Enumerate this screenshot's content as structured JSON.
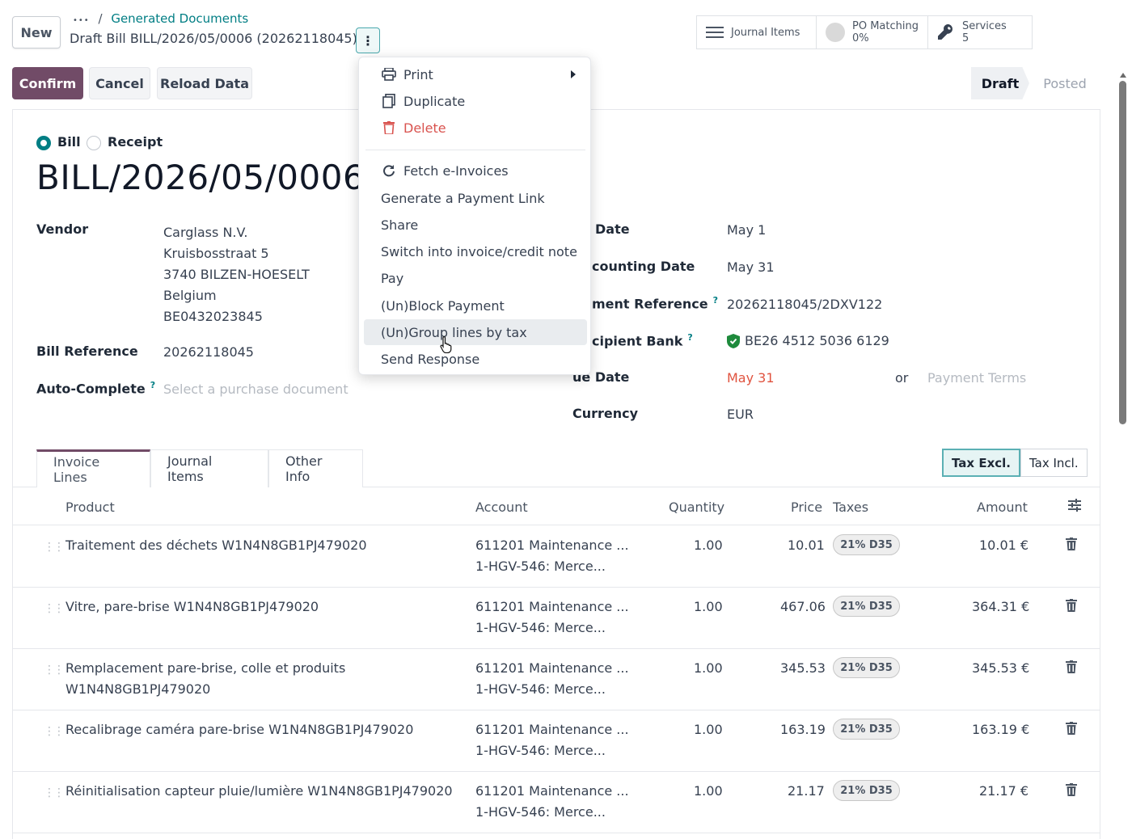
{
  "header": {
    "new_label": "New",
    "breadcrumb_ellipsis": "•••",
    "breadcrumb_sep": "/",
    "breadcrumb_link": "Generated Documents",
    "record_title": "Draft Bill BILL/2026/05/0006 (20262118045)",
    "gear_glyph": "⋮"
  },
  "smart_buttons": [
    {
      "label": "Journal Items",
      "value": "",
      "icon": "list-icon"
    },
    {
      "label": "PO Matching",
      "value": "0%",
      "icon": "progress-circle-icon"
    },
    {
      "label": "Services",
      "value": "5",
      "icon": "wrench-icon"
    }
  ],
  "actions": {
    "confirm": "Confirm",
    "cancel": "Cancel",
    "reload": "Reload Data"
  },
  "statusbar": {
    "draft": "Draft",
    "posted": "Posted"
  },
  "form": {
    "type_options": {
      "bill": "Bill",
      "receipt": "Receipt",
      "selected": "Bill"
    },
    "bill_number": "BILL/2026/05/0006",
    "vendor_label": "Vendor",
    "vendor_lines": [
      "Carglass N.V.",
      "Kruisbosstraat 5",
      "3740 BILZEN-HOESELT",
      "Belgium",
      "BE0432023845"
    ],
    "bill_reference_label": "Bill Reference",
    "bill_reference": "20262118045",
    "autocomplete_label": "Auto-Complete",
    "autocomplete_help": "?",
    "autocomplete_placeholder": "Select a purchase document",
    "date_label": "Date",
    "date": "May 1",
    "accounting_date_label": "counting Date",
    "accounting_date": "May 31",
    "payment_ref_label": "ment Reference",
    "payment_ref_help": "?",
    "payment_ref": "20262118045/2DXV122",
    "recipient_bank_label": "cipient Bank",
    "recipient_bank_help": "?",
    "recipient_bank": "BE26 4512 5036 6129",
    "due_date_label": "ue Date",
    "due_date": "May 31",
    "or_label": "or",
    "payment_terms_placeholder": "Payment Terms",
    "currency_label": "Currency",
    "currency": "EUR"
  },
  "tabs": [
    "Invoice Lines",
    "Journal Items",
    "Other Info"
  ],
  "tax_toggle": {
    "excl": "Tax Excl.",
    "incl": "Tax Incl.",
    "active": "Tax Excl."
  },
  "table": {
    "headers": {
      "product": "Product",
      "account": "Account",
      "quantity": "Quantity",
      "price": "Price",
      "taxes": "Taxes",
      "amount": "Amount"
    },
    "rows": [
      {
        "product": [
          "Traitement des déchets W1N4N8GB1PJ479020"
        ],
        "account": "611201 Maintenance ...",
        "analytic": "1-HGV-546: Merce...",
        "quantity": "1.00",
        "price": "10.01",
        "tax": "21% D35",
        "amount": "10.01 €"
      },
      {
        "product": [
          "Vitre, pare-brise W1N4N8GB1PJ479020"
        ],
        "account": "611201 Maintenance ...",
        "analytic": "1-HGV-546: Merce...",
        "quantity": "1.00",
        "price": "467.06",
        "tax": "21% D35",
        "amount": "364.31 €"
      },
      {
        "product": [
          "Remplacement pare-brise, colle et produits",
          "W1N4N8GB1PJ479020"
        ],
        "account": "611201 Maintenance ...",
        "analytic": "1-HGV-546: Merce...",
        "quantity": "1.00",
        "price": "345.53",
        "tax": "21% D35",
        "amount": "345.53 €"
      },
      {
        "product": [
          "Recalibrage caméra pare-brise W1N4N8GB1PJ479020"
        ],
        "account": "611201 Maintenance ...",
        "analytic": "1-HGV-546: Merce...",
        "quantity": "1.00",
        "price": "163.19",
        "tax": "21% D35",
        "amount": "163.19 €"
      },
      {
        "product": [
          "Réinitialisation capteur pluie/lumière W1N4N8GB1PJ479020"
        ],
        "account": "611201 Maintenance ...",
        "analytic": "1-HGV-546: Merce...",
        "quantity": "1.00",
        "price": "21.17",
        "tax": "21% D35",
        "amount": "21.17 €"
      }
    ]
  },
  "action_menu": {
    "print": "Print",
    "duplicate": "Duplicate",
    "delete": "Delete",
    "fetch": "Fetch e-Invoices",
    "payment_link": "Generate a Payment Link",
    "share": "Share",
    "switch": "Switch into invoice/credit note",
    "pay": "Pay",
    "block": "(Un)Block Payment",
    "group": "(Un)Group lines by tax",
    "send": "Send Response",
    "hovered": "(Un)Group lines by tax"
  },
  "colors": {
    "brand": "#714b67",
    "link": "#017e84",
    "danger": "#d9534f",
    "due": "#e0533f"
  }
}
